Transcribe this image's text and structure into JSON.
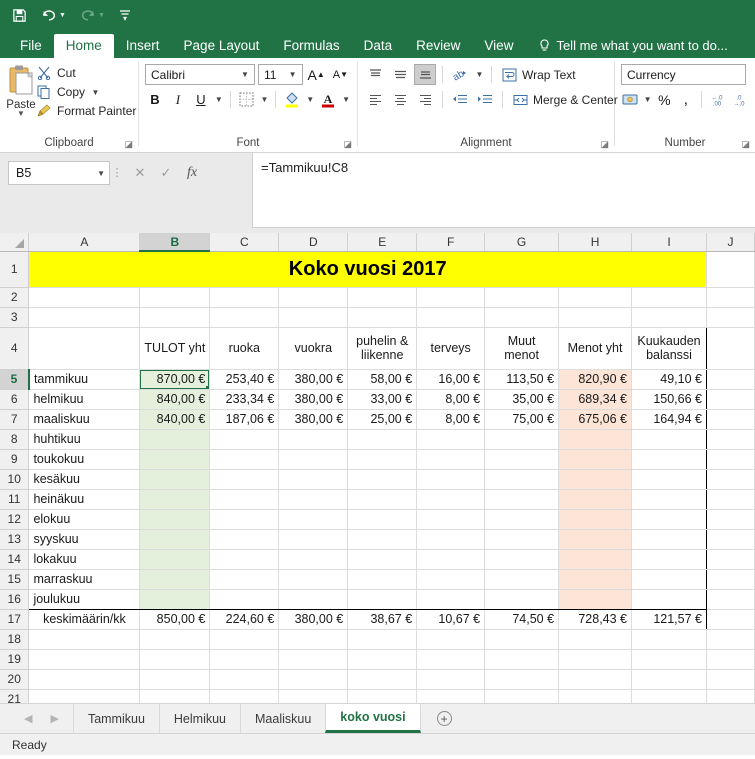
{
  "quick_access": {
    "items": [
      {
        "name": "save-icon",
        "label": "Save"
      },
      {
        "name": "undo-icon",
        "label": "Undo"
      },
      {
        "name": "redo-icon",
        "label": "Redo"
      },
      {
        "name": "customize-qat-icon",
        "label": "Customize Quick Access Toolbar"
      }
    ]
  },
  "ribbon": {
    "tabs": [
      {
        "label": "File",
        "active": false
      },
      {
        "label": "Home",
        "active": true
      },
      {
        "label": "Insert",
        "active": false
      },
      {
        "label": "Page Layout",
        "active": false
      },
      {
        "label": "Formulas",
        "active": false
      },
      {
        "label": "Data",
        "active": false
      },
      {
        "label": "Review",
        "active": false
      },
      {
        "label": "View",
        "active": false
      }
    ],
    "tell_me": "Tell me what you want to do...",
    "groups": {
      "clipboard": {
        "label": "Clipboard",
        "paste": "Paste",
        "cut": "Cut",
        "copy": "Copy",
        "format_painter": "Format Painter"
      },
      "font": {
        "label": "Font",
        "font_name": "Calibri",
        "font_size": "11",
        "grow_font": "A",
        "shrink_font": "A",
        "bold": "B",
        "italic": "I",
        "underline": "U"
      },
      "alignment": {
        "label": "Alignment",
        "wrap_text": "Wrap Text",
        "merge_center": "Merge & Center"
      },
      "number": {
        "label": "Number",
        "format": "Currency",
        "percent": "%",
        "comma": ",",
        "increase_decimal": ".00",
        "decrease_decimal": ".00"
      }
    }
  },
  "formula_bar": {
    "name_box": "B5",
    "cancel": "✕",
    "confirm": "✓",
    "fx": "fx",
    "formula": "=Tammikuu!C8"
  },
  "grid": {
    "column_headers": [
      "A",
      "B",
      "C",
      "D",
      "E",
      "F",
      "G",
      "H",
      "I",
      "J"
    ],
    "selected_column": "B",
    "selected_row": "5",
    "row_numbers": [
      "1",
      "2",
      "3",
      "4",
      "5",
      "6",
      "7",
      "8",
      "9",
      "10",
      "11",
      "12",
      "13",
      "14",
      "15",
      "16",
      "17",
      "18",
      "19",
      "20",
      "21"
    ],
    "title_banner": "Koko vuosi 2017",
    "headers": {
      "B": "TULOT yht",
      "C": "ruoka",
      "D": "vuokra",
      "E": "puhelin & liikenne",
      "F": "terveys",
      "G": "Muut menot",
      "H": "Menot yht",
      "I": "Kuukauden balanssi"
    },
    "rows": [
      {
        "row": "5",
        "A": "tammikuu",
        "B": "870,00 €",
        "C": "253,40 €",
        "D": "380,00 €",
        "E": "58,00 €",
        "F": "16,00 €",
        "G": "113,50 €",
        "H": "820,90 €",
        "I": "49,10 €"
      },
      {
        "row": "6",
        "A": "helmikuu",
        "B": "840,00 €",
        "C": "233,34 €",
        "D": "380,00 €",
        "E": "33,00 €",
        "F": "8,00 €",
        "G": "35,00 €",
        "H": "689,34 €",
        "I": "150,66 €"
      },
      {
        "row": "7",
        "A": "maaliskuu",
        "B": "840,00 €",
        "C": "187,06 €",
        "D": "380,00 €",
        "E": "25,00 €",
        "F": "8,00 €",
        "G": "75,00 €",
        "H": "675,06 €",
        "I": "164,94 €"
      },
      {
        "row": "8",
        "A": "huhtikuu",
        "B": "",
        "C": "",
        "D": "",
        "E": "",
        "F": "",
        "G": "",
        "H": "",
        "I": ""
      },
      {
        "row": "9",
        "A": "toukokuu",
        "B": "",
        "C": "",
        "D": "",
        "E": "",
        "F": "",
        "G": "",
        "H": "",
        "I": ""
      },
      {
        "row": "10",
        "A": "kesäkuu",
        "B": "",
        "C": "",
        "D": "",
        "E": "",
        "F": "",
        "G": "",
        "H": "",
        "I": ""
      },
      {
        "row": "11",
        "A": "heinäkuu",
        "B": "",
        "C": "",
        "D": "",
        "E": "",
        "F": "",
        "G": "",
        "H": "",
        "I": ""
      },
      {
        "row": "12",
        "A": "elokuu",
        "B": "",
        "C": "",
        "D": "",
        "E": "",
        "F": "",
        "G": "",
        "H": "",
        "I": ""
      },
      {
        "row": "13",
        "A": "syyskuu",
        "B": "",
        "C": "",
        "D": "",
        "E": "",
        "F": "",
        "G": "",
        "H": "",
        "I": ""
      },
      {
        "row": "14",
        "A": "lokakuu",
        "B": "",
        "C": "",
        "D": "",
        "E": "",
        "F": "",
        "G": "",
        "H": "",
        "I": ""
      },
      {
        "row": "15",
        "A": "marraskuu",
        "B": "",
        "C": "",
        "D": "",
        "E": "",
        "F": "",
        "G": "",
        "H": "",
        "I": ""
      },
      {
        "row": "16",
        "A": "joulukuu",
        "B": "",
        "C": "",
        "D": "",
        "E": "",
        "F": "",
        "G": "",
        "H": "",
        "I": ""
      }
    ],
    "summary_row": {
      "row": "17",
      "A": "keskimäärin/kk",
      "B": "850,00 €",
      "C": "224,60 €",
      "D": "380,00 €",
      "E": "38,67 €",
      "F": "10,67 €",
      "G": "74,50 €",
      "H": "728,43 €",
      "I": "121,57 €"
    },
    "colors": {
      "banner_fill": "#ffff00",
      "income_col_fill": "#e4efdc",
      "expense_col_fill": "#fce4d6",
      "selection": "#217346"
    }
  },
  "sheet_tabs": {
    "nav_prev": "◀",
    "nav_next": "▶",
    "tabs": [
      {
        "label": "Tammikuu",
        "active": false
      },
      {
        "label": "Helmikuu",
        "active": false
      },
      {
        "label": "Maaliskuu",
        "active": false
      },
      {
        "label": "koko vuosi",
        "active": true
      }
    ],
    "add_sheet": "+"
  },
  "status_bar": {
    "state": "Ready"
  }
}
